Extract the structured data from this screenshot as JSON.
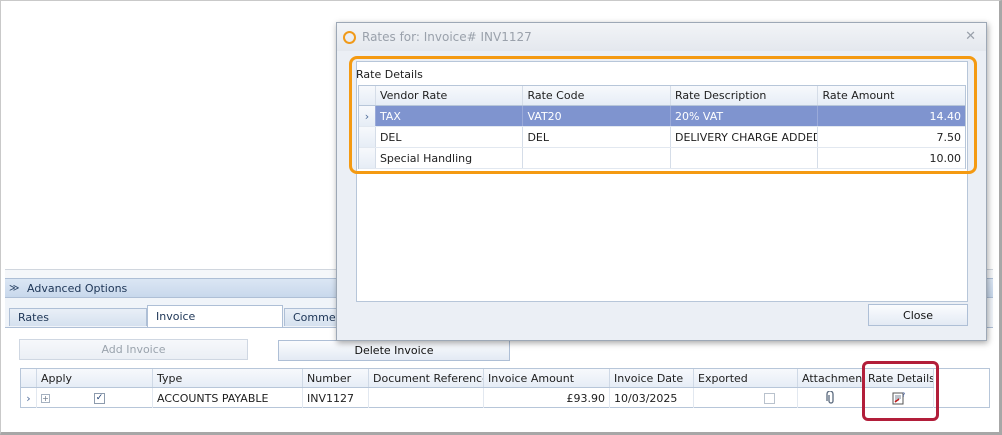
{
  "background_window": {
    "advanced_options_label": "Advanced Options",
    "tabs": [
      {
        "label": "Rates"
      },
      {
        "label": "Invoice"
      },
      {
        "label": "Comments"
      }
    ],
    "buttons": {
      "add_invoice": "Add Invoice",
      "delete_invoice": "Delete Invoice"
    },
    "invoice_grid": {
      "columns": [
        "Apply",
        "Type",
        "Number",
        "Document Reference",
        "Invoice Amount",
        "Invoice Date",
        "Exported",
        "Attachment",
        "Rate Details"
      ],
      "rows": [
        {
          "apply": "✓",
          "type": "ACCOUNTS PAYABLE",
          "number": "INV1127",
          "document_reference": "",
          "invoice_amount": "£93.90",
          "invoice_date": "10/03/2025",
          "exported": "",
          "attachment_icon": "paperclip-icon",
          "rate_details_icon": "rate-details-icon"
        }
      ]
    }
  },
  "dialog": {
    "title": "Rates for: Invoice# INV1127",
    "section_label": "Rate Details",
    "columns": [
      "Vendor Rate",
      "Rate Code",
      "Rate Description",
      "Rate Amount"
    ],
    "rows": [
      {
        "vendor_rate": "TAX",
        "rate_code": "VAT20",
        "rate_description": "20% VAT",
        "rate_amount": "14.40",
        "selected": true
      },
      {
        "vendor_rate": "DEL",
        "rate_code": "DEL",
        "rate_description": "DELIVERY CHARGE ADDED ...",
        "rate_amount": "7.50",
        "selected": false
      },
      {
        "vendor_rate": "Special Handling",
        "rate_code": "",
        "rate_description": "",
        "rate_amount": "10.00",
        "selected": false
      }
    ],
    "close_label": "Close"
  },
  "colors": {
    "highlight_orange": "#f49a12",
    "highlight_red": "#b21e3a",
    "selected_row": "#7f94cf"
  }
}
